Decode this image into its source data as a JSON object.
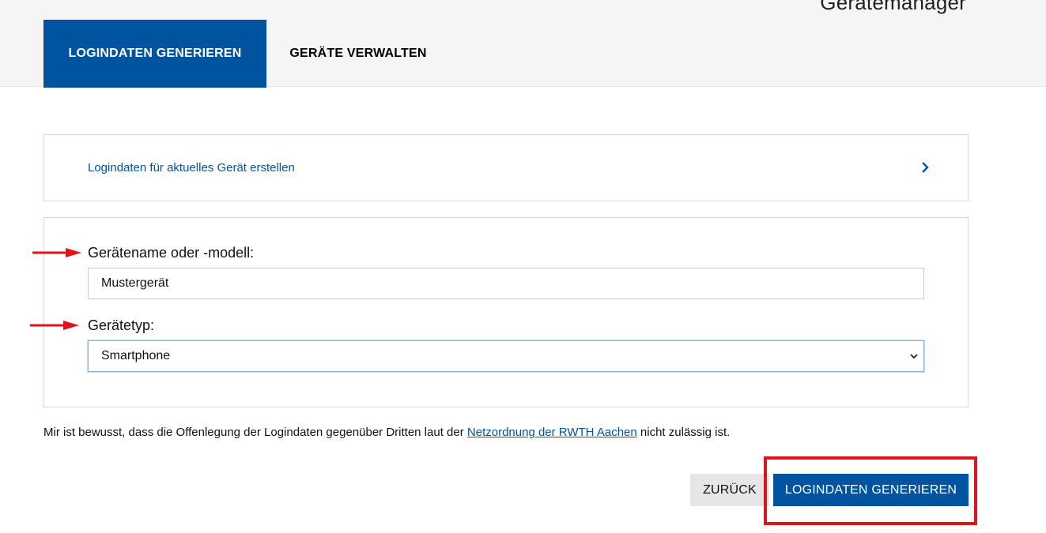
{
  "header": {
    "app_title": "Gerätemanager",
    "tabs": [
      {
        "label": "LOGINDATEN GENERIEREN",
        "active": true
      },
      {
        "label": "GERÄTE VERWALTEN",
        "active": false
      }
    ]
  },
  "current_device_link": {
    "label": "Logindaten für aktuelles Gerät erstellen",
    "icon": "chevron-right-icon"
  },
  "form": {
    "device_name_label": "Gerätename oder -modell:",
    "device_name_value": "Mustergerät",
    "device_type_label": "Gerätetyp:",
    "device_type_value": "Smartphone"
  },
  "notice": {
    "text_before": "Mir ist bewusst, dass die Offenlegung der Logindaten gegenüber Dritten laut der ",
    "link_text": "Netzordnung der RWTH Aachen",
    "text_after": " nicht zulässig ist."
  },
  "actions": {
    "back_label": "ZURÜCK",
    "generate_label": "LOGINDATEN GENERIEREN"
  },
  "colors": {
    "brand_blue": "#00549f",
    "annotation_red": "#e2131b",
    "header_bg": "#f5f5f5"
  }
}
